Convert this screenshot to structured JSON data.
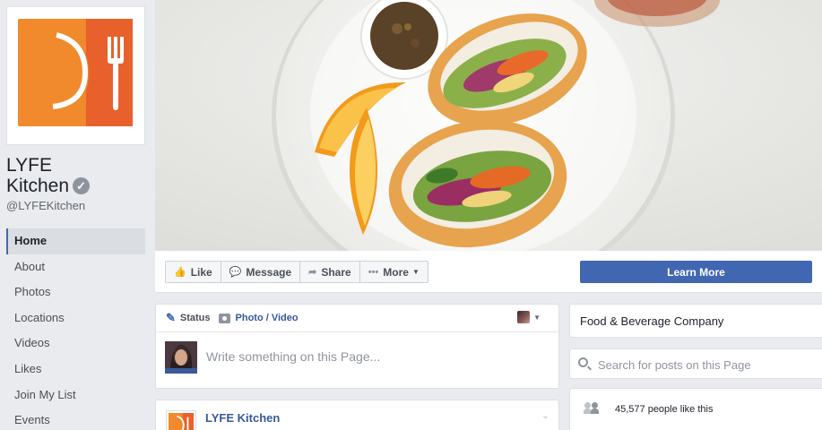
{
  "page": {
    "name_line1": "LYFE",
    "name_line2": "Kitchen",
    "handle": "@LYFEKitchen",
    "verified_icon": "verified-check-icon",
    "brand_color": "#f08a2c"
  },
  "nav": {
    "items": [
      {
        "label": "Home",
        "active": true
      },
      {
        "label": "About"
      },
      {
        "label": "Photos"
      },
      {
        "label": "Locations"
      },
      {
        "label": "Videos"
      },
      {
        "label": "Likes"
      },
      {
        "label": "Join My List"
      },
      {
        "label": "Events"
      }
    ]
  },
  "actions": {
    "like": "Like",
    "message": "Message",
    "share": "Share",
    "more": "More",
    "cta": "Learn More",
    "cta_color": "#4267b2"
  },
  "composer": {
    "status_tab": "Status",
    "photo_tab": "Photo / Video",
    "placeholder": "Write something on this Page..."
  },
  "post": {
    "author": "LYFE Kitchen"
  },
  "sidebar": {
    "category": "Food & Beverage Company",
    "search_placeholder": "Search for posts on this Page",
    "likes_text": "45,577 people like this"
  }
}
